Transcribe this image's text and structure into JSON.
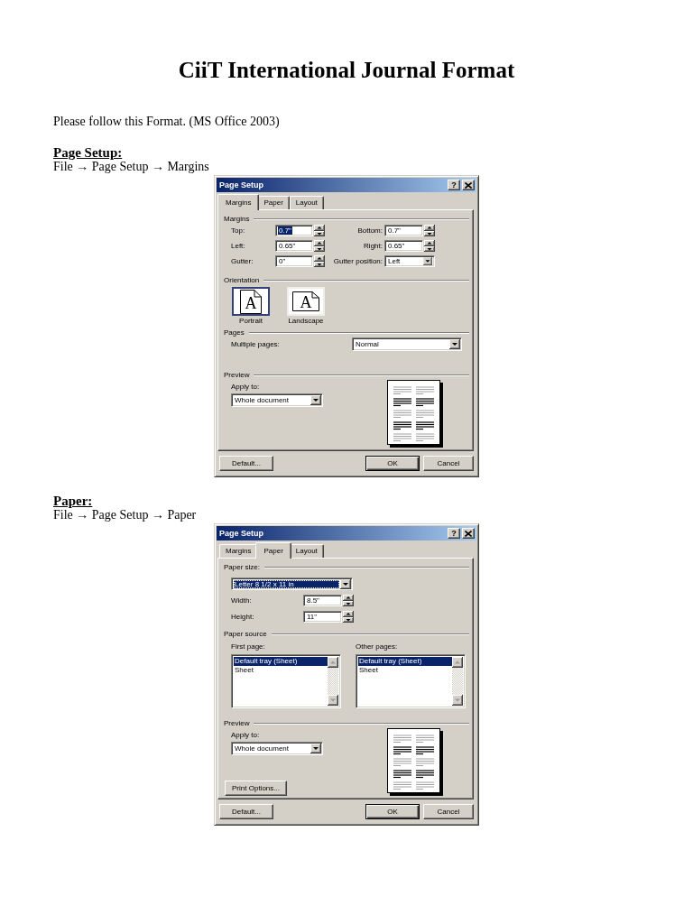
{
  "document": {
    "title": "CiiT International Journal Format",
    "intro": "Please follow this Format. (MS Office 2003)"
  },
  "sections": [
    {
      "heading": "Page Setup:",
      "path": "File → Page Setup → Margins",
      "dialog": {
        "title": "Page Setup",
        "help": "?",
        "tabs": [
          {
            "label": "Margins",
            "selected": true
          },
          {
            "label": "Paper",
            "selected": false
          },
          {
            "label": "Layout",
            "selected": false
          }
        ],
        "groups": [
          {
            "kind": "margins",
            "label": "Margins",
            "fields": [
              {
                "kind": "spin",
                "label": "Top:",
                "value": "0.7\"",
                "selected": true
              },
              {
                "kind": "spin",
                "label": "Bottom:",
                "value": "0.7\"",
                "selected": false
              },
              {
                "kind": "spin",
                "label": "Left:",
                "value": "0.65\"",
                "selected": false
              },
              {
                "kind": "spin",
                "label": "Right:",
                "value": "0.65\"",
                "selected": false
              },
              {
                "kind": "spin",
                "label": "Gutter:",
                "value": "0\"",
                "selected": false
              },
              {
                "kind": "dropdown",
                "label": "Gutter position:",
                "value": "Left",
                "selected": false
              }
            ]
          },
          {
            "kind": "orientation",
            "label": "Orientation",
            "options": [
              {
                "kind": "portrait",
                "glyph": "A",
                "label": "Portrait",
                "selected": true
              },
              {
                "kind": "landscape",
                "glyph": "A",
                "label": "Landscape",
                "selected": false
              }
            ]
          },
          {
            "kind": "pages",
            "label": "Pages",
            "field_label": "Multiple pages:",
            "value": "Normal"
          },
          {
            "kind": "preview",
            "label": "Preview",
            "field_label": "Apply to:",
            "value": "Whole document"
          }
        ],
        "buttons": [
          {
            "label": "Default...",
            "default": false
          },
          {
            "label": "OK",
            "default": true
          },
          {
            "label": "Cancel",
            "default": false
          }
        ]
      }
    },
    {
      "heading": "Paper:",
      "path": "File → Page Setup → Paper",
      "dialog": {
        "title": "Page Setup",
        "help": "?",
        "tabs": [
          {
            "label": "Margins",
            "selected": false
          },
          {
            "label": "Paper",
            "selected": true
          },
          {
            "label": "Layout",
            "selected": false
          }
        ],
        "groups": [
          {
            "kind": "paper_size",
            "label": "Paper size:",
            "value": "Letter 8 1/2 x 11 in",
            "selected": true,
            "fields": [
              {
                "kind": "spin",
                "label": "Width:",
                "value": "8.5\"",
                "selected": false
              },
              {
                "kind": "spin",
                "label": "Height:",
                "value": "11\"",
                "selected": false
              }
            ]
          },
          {
            "kind": "paper_source",
            "label": "Paper source",
            "lists": [
              {
                "label": "First page:",
                "items": [
                  {
                    "text": "Default tray (Sheet)",
                    "selected": true
                  },
                  {
                    "text": "Sheet",
                    "selected": false
                  }
                ]
              },
              {
                "label": "Other pages:",
                "items": [
                  {
                    "text": "Default tray (Sheet)",
                    "selected": true
                  },
                  {
                    "text": "Sheet",
                    "selected": false
                  }
                ]
              }
            ]
          },
          {
            "kind": "preview",
            "label": "Preview",
            "field_label": "Apply to:",
            "value": "Whole document",
            "button": "Print Options..."
          }
        ],
        "buttons": [
          {
            "label": "Default...",
            "default": false
          },
          {
            "label": "OK",
            "default": true
          },
          {
            "label": "Cancel",
            "default": false
          }
        ]
      }
    }
  ]
}
